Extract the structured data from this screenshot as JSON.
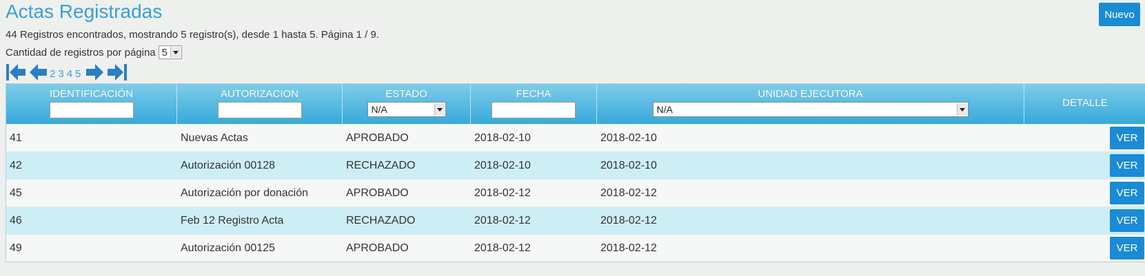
{
  "page": {
    "title": "Actas Registradas",
    "new_label": "Nuevo",
    "summary": "44 Registros encontrados, mostrando 5 registro(s), desde 1 hasta 5. Página 1 / 9.",
    "per_page_label": "Cantidad de registros por página",
    "per_page_value": "5"
  },
  "pager": {
    "pages": [
      "2",
      "3",
      "4",
      "5"
    ],
    "icons": [
      "first-page-icon",
      "previous-page-icon",
      "next-page-icon",
      "last-page-icon"
    ]
  },
  "table": {
    "columns": {
      "identificacion": "IDENTIFICACIÓN",
      "autorizacion": "AUTORIZACION",
      "estado": "ESTADO",
      "fecha": "FECHA",
      "unidad": "UNIDAD EJECUTORA",
      "detalle": "DETALLE"
    },
    "filters": {
      "estado_selected": "N/A",
      "unidad_selected": "N/A"
    },
    "rows": [
      {
        "id": "41",
        "autorizacion": "Nuevas Actas",
        "estado": "APROBADO",
        "fecha": "2018-02-10",
        "unidad": "2018-02-10",
        "action": "VER"
      },
      {
        "id": "42",
        "autorizacion": "Autorización 00128",
        "estado": "RECHAZADO",
        "fecha": "2018-02-10",
        "unidad": "2018-02-10",
        "action": "VER"
      },
      {
        "id": "45",
        "autorizacion": "Autorización por donación",
        "estado": "APROBADO",
        "fecha": "2018-02-12",
        "unidad": "2018-02-12",
        "action": "VER"
      },
      {
        "id": "46",
        "autorizacion": "Feb 12 Registro Acta",
        "estado": "RECHAZADO",
        "fecha": "2018-02-12",
        "unidad": "2018-02-12",
        "action": "VER"
      },
      {
        "id": "49",
        "autorizacion": "Autorización 00125",
        "estado": "APROBADO",
        "fecha": "2018-02-12",
        "unidad": "2018-02-12",
        "action": "VER"
      }
    ]
  },
  "colors": {
    "accent": "#1a8bd4",
    "title": "#3a9fd8",
    "row_alt": "#cdeef5"
  }
}
